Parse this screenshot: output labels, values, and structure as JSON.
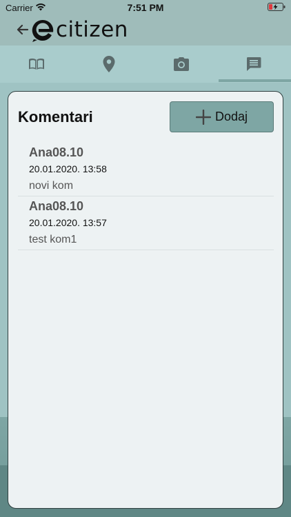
{
  "status_bar": {
    "carrier": "Carrier",
    "time": "7:51 PM"
  },
  "header": {
    "logo_text": "citizen",
    "back_icon": "arrow-left-icon"
  },
  "tabs": [
    {
      "name": "info",
      "icon": "book-icon",
      "active": false
    },
    {
      "name": "location",
      "icon": "map-pin-icon",
      "active": false
    },
    {
      "name": "photo",
      "icon": "camera-icon",
      "active": false
    },
    {
      "name": "comments",
      "icon": "comment-icon",
      "active": true
    }
  ],
  "main": {
    "title": "Komentari",
    "add_label": "Dodaj",
    "comments": [
      {
        "author": "Ana08.10",
        "date": "20.01.2020. 13:58",
        "text": "novi kom"
      },
      {
        "author": "Ana08.10",
        "date": "20.01.2020. 13:57",
        "text": "test kom1"
      }
    ]
  },
  "colors": {
    "accent": "#7ea6a4",
    "tab_bar": "#a9cccc",
    "card": "#edf2f3",
    "icon": "#5b6b6c"
  }
}
